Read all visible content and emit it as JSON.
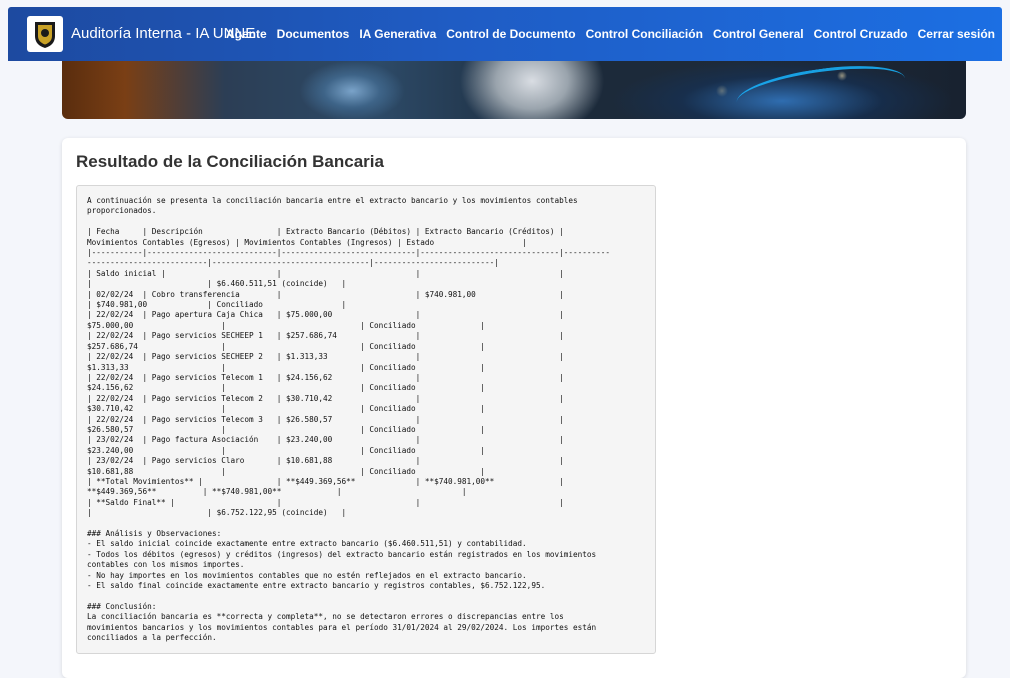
{
  "navbar": {
    "brand": "Auditoría Interna - IA UNNE",
    "links": [
      "Agente",
      "Documentos",
      "IA Generativa",
      "Control de Documento",
      "Control Conciliación",
      "Control General",
      "Control Cruzado",
      "Cerrar sesión"
    ],
    "color_start": "#1d4aa0",
    "color_end": "#1c6fe3"
  },
  "logo": {
    "icon": "university-seal-icon"
  },
  "banner": {
    "icon": "ai-eye-banner-image"
  },
  "main": {
    "title": "Resultado de la Conciliación Bancaria",
    "result_text": "A continuación se presenta la conciliación bancaria entre el extracto bancario y los movimientos contables\nproporcionados.\n\n| Fecha     | Descripción                | Extracto Bancario (Débitos) | Extracto Bancario (Créditos) |\nMovimientos Contables (Egresos) | Movimientos Contables (Ingresos) | Estado                   |\n|-----------|----------------------------|-----------------------------|------------------------------|----------\n--------------------------|----------------------------------|--------------------------|\n| Saldo inicial |                        |                             |                              |\n|                         | $6.460.511,51 (coincide)   |\n| 02/02/24  | Cobro transferencia        |                             | $740.981,00                  |\n| $740.981,00             | Conciliado                 |\n| 22/02/24  | Pago apertura Caja Chica   | $75.000,00                  |                              |\n$75.000,00                   |                             | Conciliado              |\n| 22/02/24  | Pago servicios SECHEEP 1   | $257.686,74                 |                              |\n$257.686,74                  |                             | Conciliado              |\n| 22/02/24  | Pago servicios SECHEEP 2   | $1.313,33                   |                              |\n$1.313,33                    |                             | Conciliado              |\n| 22/02/24  | Pago servicios Telecom 1   | $24.156,62                  |                              |\n$24.156,62                   |                             | Conciliado              |\n| 22/02/24  | Pago servicios Telecom 2   | $30.710,42                  |                              |\n$30.710,42                   |                             | Conciliado              |\n| 22/02/24  | Pago servicios Telecom 3   | $26.580,57                  |                              |\n$26.580,57                   |                             | Conciliado              |\n| 23/02/24  | Pago factura Asociación    | $23.240,00                  |                              |\n$23.240,00                   |                             | Conciliado              |\n| 23/02/24  | Pago servicios Claro       | $10.681,88                  |                              |\n$10.681,88                   |                             | Conciliado              |\n| **Total Movimientos** |                | **$449.369,56**             | **$740.981,00**              |\n**$449.369,56**          | **$740.981,00**            |                          |\n| **Saldo Final** |                      |                             |                              |\n|                         | $6.752.122,95 (coincide)   |\n\n### Análisis y Observaciones:\n- El saldo inicial coincide exactamente entre extracto bancario ($6.460.511,51) y contabilidad.\n- Todos los débitos (egresos) y créditos (ingresos) del extracto bancario están registrados en los movimientos\ncontables con los mismos importes.\n- No hay importes en los movimientos contables que no estén reflejados en el extracto bancario.\n- El saldo final coincide exactamente entre extracto bancario y registros contables, $6.752.122,95.\n\n### Conclusión:\nLa conciliación bancaria es **correcta y completa**, no se detectaron errores o discrepancias entre los\nmovimientos bancarios y los movimientos contables para el período 31/01/2024 al 29/02/2024. Los importes están\nconciliados a la perfección."
  }
}
